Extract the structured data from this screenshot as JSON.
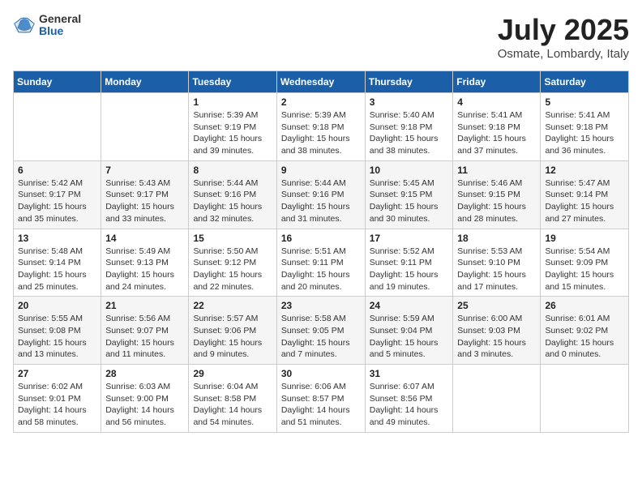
{
  "header": {
    "logo": {
      "general": "General",
      "blue": "Blue"
    },
    "title": "July 2025",
    "location": "Osmate, Lombardy, Italy"
  },
  "calendar": {
    "weekdays": [
      "Sunday",
      "Monday",
      "Tuesday",
      "Wednesday",
      "Thursday",
      "Friday",
      "Saturday"
    ],
    "weeks": [
      [
        {
          "day": "",
          "detail": ""
        },
        {
          "day": "",
          "detail": ""
        },
        {
          "day": "1",
          "detail": "Sunrise: 5:39 AM\nSunset: 9:19 PM\nDaylight: 15 hours\nand 39 minutes."
        },
        {
          "day": "2",
          "detail": "Sunrise: 5:39 AM\nSunset: 9:18 PM\nDaylight: 15 hours\nand 38 minutes."
        },
        {
          "day": "3",
          "detail": "Sunrise: 5:40 AM\nSunset: 9:18 PM\nDaylight: 15 hours\nand 38 minutes."
        },
        {
          "day": "4",
          "detail": "Sunrise: 5:41 AM\nSunset: 9:18 PM\nDaylight: 15 hours\nand 37 minutes."
        },
        {
          "day": "5",
          "detail": "Sunrise: 5:41 AM\nSunset: 9:18 PM\nDaylight: 15 hours\nand 36 minutes."
        }
      ],
      [
        {
          "day": "6",
          "detail": "Sunrise: 5:42 AM\nSunset: 9:17 PM\nDaylight: 15 hours\nand 35 minutes."
        },
        {
          "day": "7",
          "detail": "Sunrise: 5:43 AM\nSunset: 9:17 PM\nDaylight: 15 hours\nand 33 minutes."
        },
        {
          "day": "8",
          "detail": "Sunrise: 5:44 AM\nSunset: 9:16 PM\nDaylight: 15 hours\nand 32 minutes."
        },
        {
          "day": "9",
          "detail": "Sunrise: 5:44 AM\nSunset: 9:16 PM\nDaylight: 15 hours\nand 31 minutes."
        },
        {
          "day": "10",
          "detail": "Sunrise: 5:45 AM\nSunset: 9:15 PM\nDaylight: 15 hours\nand 30 minutes."
        },
        {
          "day": "11",
          "detail": "Sunrise: 5:46 AM\nSunset: 9:15 PM\nDaylight: 15 hours\nand 28 minutes."
        },
        {
          "day": "12",
          "detail": "Sunrise: 5:47 AM\nSunset: 9:14 PM\nDaylight: 15 hours\nand 27 minutes."
        }
      ],
      [
        {
          "day": "13",
          "detail": "Sunrise: 5:48 AM\nSunset: 9:14 PM\nDaylight: 15 hours\nand 25 minutes."
        },
        {
          "day": "14",
          "detail": "Sunrise: 5:49 AM\nSunset: 9:13 PM\nDaylight: 15 hours\nand 24 minutes."
        },
        {
          "day": "15",
          "detail": "Sunrise: 5:50 AM\nSunset: 9:12 PM\nDaylight: 15 hours\nand 22 minutes."
        },
        {
          "day": "16",
          "detail": "Sunrise: 5:51 AM\nSunset: 9:11 PM\nDaylight: 15 hours\nand 20 minutes."
        },
        {
          "day": "17",
          "detail": "Sunrise: 5:52 AM\nSunset: 9:11 PM\nDaylight: 15 hours\nand 19 minutes."
        },
        {
          "day": "18",
          "detail": "Sunrise: 5:53 AM\nSunset: 9:10 PM\nDaylight: 15 hours\nand 17 minutes."
        },
        {
          "day": "19",
          "detail": "Sunrise: 5:54 AM\nSunset: 9:09 PM\nDaylight: 15 hours\nand 15 minutes."
        }
      ],
      [
        {
          "day": "20",
          "detail": "Sunrise: 5:55 AM\nSunset: 9:08 PM\nDaylight: 15 hours\nand 13 minutes."
        },
        {
          "day": "21",
          "detail": "Sunrise: 5:56 AM\nSunset: 9:07 PM\nDaylight: 15 hours\nand 11 minutes."
        },
        {
          "day": "22",
          "detail": "Sunrise: 5:57 AM\nSunset: 9:06 PM\nDaylight: 15 hours\nand 9 minutes."
        },
        {
          "day": "23",
          "detail": "Sunrise: 5:58 AM\nSunset: 9:05 PM\nDaylight: 15 hours\nand 7 minutes."
        },
        {
          "day": "24",
          "detail": "Sunrise: 5:59 AM\nSunset: 9:04 PM\nDaylight: 15 hours\nand 5 minutes."
        },
        {
          "day": "25",
          "detail": "Sunrise: 6:00 AM\nSunset: 9:03 PM\nDaylight: 15 hours\nand 3 minutes."
        },
        {
          "day": "26",
          "detail": "Sunrise: 6:01 AM\nSunset: 9:02 PM\nDaylight: 15 hours\nand 0 minutes."
        }
      ],
      [
        {
          "day": "27",
          "detail": "Sunrise: 6:02 AM\nSunset: 9:01 PM\nDaylight: 14 hours\nand 58 minutes."
        },
        {
          "day": "28",
          "detail": "Sunrise: 6:03 AM\nSunset: 9:00 PM\nDaylight: 14 hours\nand 56 minutes."
        },
        {
          "day": "29",
          "detail": "Sunrise: 6:04 AM\nSunset: 8:58 PM\nDaylight: 14 hours\nand 54 minutes."
        },
        {
          "day": "30",
          "detail": "Sunrise: 6:06 AM\nSunset: 8:57 PM\nDaylight: 14 hours\nand 51 minutes."
        },
        {
          "day": "31",
          "detail": "Sunrise: 6:07 AM\nSunset: 8:56 PM\nDaylight: 14 hours\nand 49 minutes."
        },
        {
          "day": "",
          "detail": ""
        },
        {
          "day": "",
          "detail": ""
        }
      ]
    ]
  }
}
